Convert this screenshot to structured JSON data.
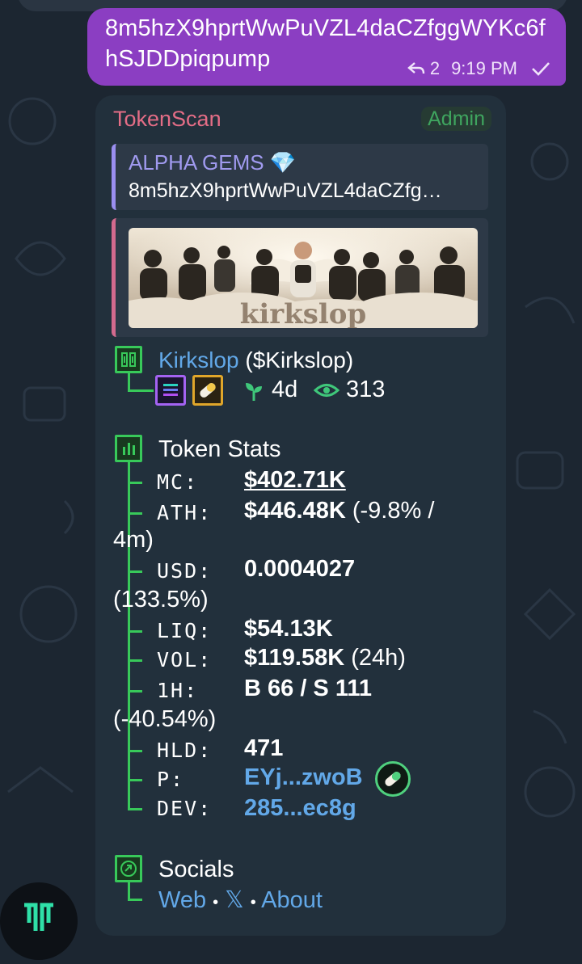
{
  "outgoing": {
    "text": "8m5hzX9hprtWwPuVZL4daCZfggWYKc6fhSJDDpiqpump",
    "reply_count": "2",
    "time": "9:19 PM"
  },
  "incoming": {
    "sender": "TokenScan",
    "badge": "Admin",
    "reply_to": {
      "title": "ALPHA GEMS",
      "text": "8m5hzX9hprtWwPuVZL4daCZfg…"
    },
    "banner_word": "kirkslop",
    "token": {
      "name": "Kirkslop",
      "ticker": "($Kirkslop)",
      "age": "4d",
      "views": "313"
    },
    "stats": {
      "title": "Token Stats",
      "mc_label": "MC:",
      "mc_value": "$402.71K",
      "ath_label": "ATH:",
      "ath_value": "$446.48K",
      "ath_change_a": "(-9.8% /",
      "ath_change_b": "4m)",
      "usd_label": "USD:",
      "usd_value": "0.0004027",
      "usd_change": "(133.5%)",
      "liq_label": "LIQ:",
      "liq_value": "$54.13K",
      "vol_label": "VOL:",
      "vol_value": "$119.58K",
      "vol_period": "(24h)",
      "h1_label": "1H:",
      "h1_value": "B 66 / S 111",
      "h1_change": "(-40.54%)",
      "hld_label": "HLD:",
      "hld_value": "471",
      "p_label": "P:",
      "p_value": "EYj...zwoB",
      "dev_label": "DEV:",
      "dev_value": "285...ec8g"
    },
    "socials": {
      "title": "Socials",
      "web": "Web",
      "x": "𝕏",
      "about": "About",
      "sep": "•"
    }
  },
  "icons": {
    "reply": "reply-arrow-icon",
    "check": "check-icon",
    "diamond": "diamond-icon",
    "sprout": "sprout-icon",
    "eye": "eye-icon",
    "pill": "pill-icon",
    "chart": "chart-icon",
    "link": "link-icon"
  },
  "colors": {
    "outgoing_bubble": "#8b3ec2",
    "incoming_bubble": "#22303c",
    "sender": "#e46d86",
    "tree": "#38c95a",
    "link": "#62a8e8"
  }
}
